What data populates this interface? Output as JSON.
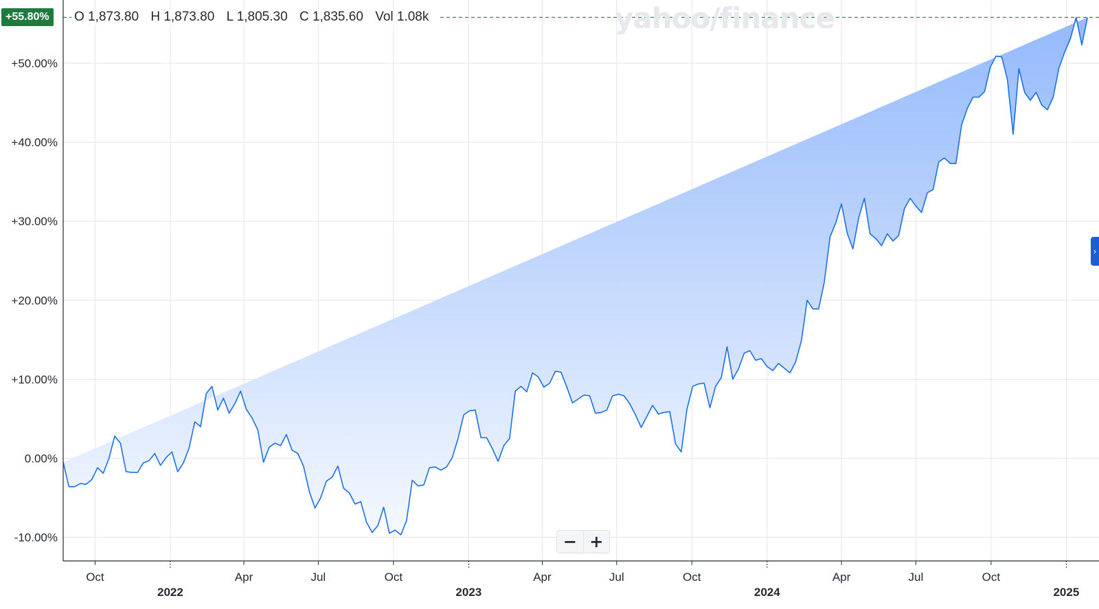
{
  "ohlc": {
    "open": "O 1,873.80",
    "high": "H 1,873.80",
    "low": "L 1,805.30",
    "close": "C 1,835.60",
    "volume": "Vol 1.08k"
  },
  "price_badge": "+55.80%",
  "watermark": "yahoo/finance",
  "zoom": {
    "out_label": "−",
    "in_label": "+"
  },
  "side_tab_label": "›",
  "colors": {
    "line": "#1a6fe8",
    "fill_top": "#8fb6fb",
    "fill_bottom": "#f5f9ff",
    "badge": "#1f7a3f",
    "reference_line": "#1f7a3f",
    "grid": "#e3e5e9",
    "axis": "#232a31"
  },
  "chart_data": {
    "type": "area",
    "x_unit": "date",
    "xlim": [
      "2021-08-23",
      "2025-02-10"
    ],
    "ylim": [
      -13,
      58
    ],
    "y_ticks": [
      -10,
      0,
      10,
      20,
      30,
      40,
      50
    ],
    "y_tick_labels": [
      "-10.00%",
      "0.00%",
      "+10.00%",
      "+20.00%",
      "+30.00%",
      "+40.00%",
      "+50.00%"
    ],
    "x_month_ticks": [
      {
        "date": "2021-10-01",
        "label": "Oct"
      },
      {
        "date": "2022-04-01",
        "label": "Apr"
      },
      {
        "date": "2022-07-01",
        "label": "Jul"
      },
      {
        "date": "2022-10-01",
        "label": "Oct"
      },
      {
        "date": "2023-04-01",
        "label": "Apr"
      },
      {
        "date": "2023-07-01",
        "label": "Jul"
      },
      {
        "date": "2023-10-01",
        "label": "Oct"
      },
      {
        "date": "2024-04-01",
        "label": "Apr"
      },
      {
        "date": "2024-07-01",
        "label": "Jul"
      },
      {
        "date": "2024-10-01",
        "label": "Oct"
      }
    ],
    "x_year_ticks": [
      {
        "date": "2022-01-01",
        "label": "2022"
      },
      {
        "date": "2023-01-01",
        "label": "2023"
      },
      {
        "date": "2024-01-01",
        "label": "2024"
      },
      {
        "date": "2025-01-01",
        "label": "2025"
      }
    ],
    "reference_value": 55.8,
    "grid": true,
    "x": [
      "2021-08-23",
      "2021-08-30",
      "2021-09-06",
      "2021-09-13",
      "2021-09-20",
      "2021-09-27",
      "2021-10-04",
      "2021-10-11",
      "2021-10-18",
      "2021-10-25",
      "2021-11-01",
      "2021-11-08",
      "2021-11-15",
      "2021-11-22",
      "2021-11-29",
      "2021-12-06",
      "2021-12-13",
      "2021-12-20",
      "2021-12-27",
      "2022-01-03",
      "2022-01-10",
      "2022-01-17",
      "2022-01-24",
      "2022-01-31",
      "2022-02-07",
      "2022-02-14",
      "2022-02-21",
      "2022-02-28",
      "2022-03-07",
      "2022-03-14",
      "2022-03-21",
      "2022-03-28",
      "2022-04-04",
      "2022-04-11",
      "2022-04-18",
      "2022-04-25",
      "2022-05-02",
      "2022-05-09",
      "2022-05-16",
      "2022-05-23",
      "2022-05-30",
      "2022-06-06",
      "2022-06-13",
      "2022-06-20",
      "2022-06-27",
      "2022-07-04",
      "2022-07-11",
      "2022-07-18",
      "2022-07-25",
      "2022-08-01",
      "2022-08-08",
      "2022-08-15",
      "2022-08-22",
      "2022-08-29",
      "2022-09-05",
      "2022-09-12",
      "2022-09-19",
      "2022-09-26",
      "2022-10-03",
      "2022-10-10",
      "2022-10-17",
      "2022-10-24",
      "2022-10-31",
      "2022-11-07",
      "2022-11-14",
      "2022-11-21",
      "2022-11-28",
      "2022-12-05",
      "2022-12-12",
      "2022-12-19",
      "2022-12-26",
      "2023-01-02",
      "2023-01-09",
      "2023-01-16",
      "2023-01-23",
      "2023-01-30",
      "2023-02-06",
      "2023-02-13",
      "2023-02-20",
      "2023-02-27",
      "2023-03-06",
      "2023-03-13",
      "2023-03-20",
      "2023-03-27",
      "2023-04-03",
      "2023-04-10",
      "2023-04-17",
      "2023-04-24",
      "2023-05-01",
      "2023-05-08",
      "2023-05-15",
      "2023-05-22",
      "2023-05-29",
      "2023-06-05",
      "2023-06-12",
      "2023-06-19",
      "2023-06-26",
      "2023-07-03",
      "2023-07-10",
      "2023-07-17",
      "2023-07-24",
      "2023-07-31",
      "2023-08-07",
      "2023-08-14",
      "2023-08-21",
      "2023-08-28",
      "2023-09-04",
      "2023-09-11",
      "2023-09-18",
      "2023-09-25",
      "2023-10-02",
      "2023-10-09",
      "2023-10-16",
      "2023-10-23",
      "2023-10-30",
      "2023-11-06",
      "2023-11-13",
      "2023-11-20",
      "2023-11-27",
      "2023-12-04",
      "2023-12-11",
      "2023-12-18",
      "2023-12-25",
      "2024-01-01",
      "2024-01-08",
      "2024-01-15",
      "2024-01-22",
      "2024-01-29",
      "2024-02-05",
      "2024-02-12",
      "2024-02-19",
      "2024-02-26",
      "2024-03-04",
      "2024-03-11",
      "2024-03-18",
      "2024-03-25",
      "2024-04-01",
      "2024-04-08",
      "2024-04-15",
      "2024-04-22",
      "2024-04-29",
      "2024-05-06",
      "2024-05-13",
      "2024-05-20",
      "2024-05-27",
      "2024-06-03",
      "2024-06-10",
      "2024-06-17",
      "2024-06-24",
      "2024-07-01",
      "2024-07-08",
      "2024-07-15",
      "2024-07-22",
      "2024-07-29",
      "2024-08-05",
      "2024-08-12",
      "2024-08-19",
      "2024-08-26",
      "2024-09-02",
      "2024-09-09",
      "2024-09-16",
      "2024-09-23",
      "2024-09-30",
      "2024-10-07",
      "2024-10-14",
      "2024-10-21",
      "2024-10-28",
      "2024-11-04",
      "2024-11-11",
      "2024-11-18",
      "2024-11-25",
      "2024-12-02",
      "2024-12-09",
      "2024-12-16",
      "2024-12-23",
      "2024-12-30",
      "2025-01-06",
      "2025-01-13",
      "2025-01-20",
      "2025-01-27",
      "2025-02-03",
      "2025-02-10"
    ],
    "values": [
      -0.5,
      -3.6,
      -3.6,
      -3.2,
      -3.3,
      -2.7,
      -1.2,
      -1.9,
      0.0,
      2.8,
      1.9,
      -1.7,
      -1.8,
      -1.8,
      -0.6,
      -0.3,
      0.6,
      -0.9,
      0.1,
      0.8,
      -1.7,
      -0.6,
      1.3,
      4.6,
      4.0,
      8.2,
      9.1,
      6.1,
      7.6,
      5.7,
      6.9,
      8.5,
      6.2,
      5.1,
      3.6,
      -0.5,
      1.4,
      1.9,
      1.6,
      3.0,
      1.0,
      0.6,
      -1.0,
      -4.2,
      -6.3,
      -5.0,
      -2.9,
      -2.4,
      -1.0,
      -3.8,
      -4.4,
      -5.8,
      -5.5,
      -8.1,
      -9.4,
      -8.5,
      -6.2,
      -9.5,
      -9.1,
      -9.7,
      -7.9,
      -2.8,
      -3.5,
      -3.4,
      -1.2,
      -1.1,
      -1.5,
      -1.1,
      0.1,
      2.5,
      5.5,
      6.0,
      6.1,
      2.6,
      2.6,
      1.2,
      -0.4,
      1.6,
      2.5,
      8.5,
      9.1,
      8.4,
      10.8,
      10.3,
      9.0,
      9.5,
      11.0,
      10.9,
      9.0,
      7.0,
      7.5,
      8.0,
      7.9,
      5.7,
      5.8,
      6.1,
      7.9,
      8.1,
      7.9,
      6.9,
      5.5,
      3.9,
      5.3,
      6.7,
      5.6,
      5.8,
      5.9,
      1.8,
      0.8,
      6.2,
      9.1,
      9.4,
      9.5,
      6.4,
      9.1,
      10.2,
      14.1,
      10.0,
      11.3,
      13.3,
      13.6,
      12.4,
      12.6,
      11.6,
      11.1,
      12.0,
      11.4,
      10.8,
      12.2,
      14.9,
      20.0,
      18.9,
      18.9,
      22.3,
      28.0,
      29.8,
      32.2,
      28.5,
      26.5,
      30.4,
      32.9,
      28.4,
      27.8,
      26.9,
      28.4,
      27.5,
      28.2,
      31.6,
      32.9,
      31.9,
      31.1,
      33.6,
      34.0,
      37.5,
      38.0,
      37.3,
      37.3,
      42.2,
      44.3,
      45.7,
      45.7,
      46.4,
      49.5,
      50.9,
      50.8,
      47.9,
      41.0,
      49.3,
      46.3,
      45.3,
      46.3,
      44.7,
      44.1,
      45.7,
      49.4,
      51.4,
      53.1,
      55.8,
      52.3,
      55.8
    ]
  }
}
